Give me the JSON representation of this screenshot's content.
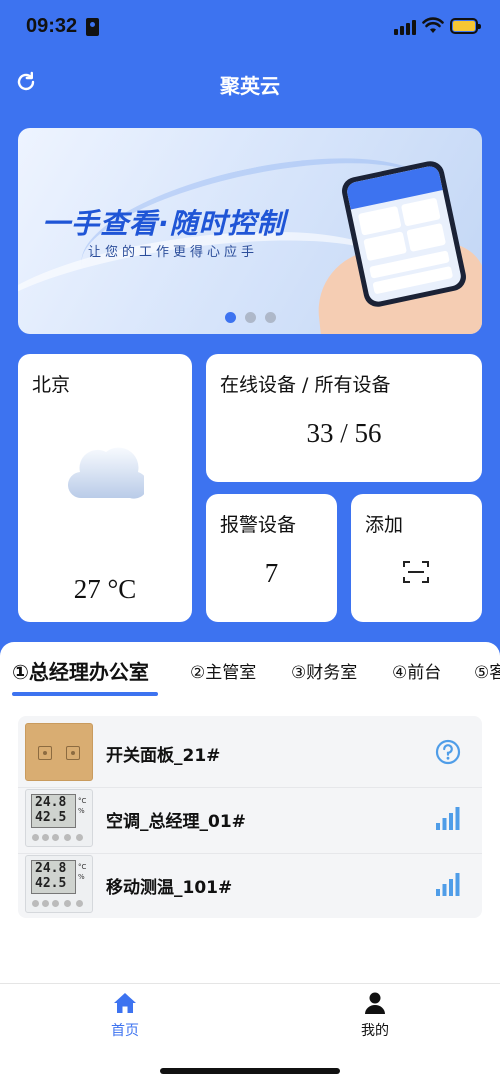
{
  "status_bar": {
    "time": "09:32"
  },
  "header": {
    "title": "聚英云"
  },
  "banner": {
    "title": "一手查看·随时控制",
    "subtitle": "让您的工作更得心应手",
    "active_dot": 0
  },
  "weather": {
    "city": "北京",
    "temperature": "27 °C",
    "icon": "cloud-icon"
  },
  "online": {
    "label": "在线设备 / 所有设备",
    "value": "33 / 56"
  },
  "alarm": {
    "label": "报警设备",
    "value": "7"
  },
  "add": {
    "label": "添加",
    "icon": "scan-icon"
  },
  "tabs": [
    {
      "label": "①总经理办公室"
    },
    {
      "label": "②主管室"
    },
    {
      "label": "③财务室"
    },
    {
      "label": "④前台"
    },
    {
      "label": "⑤客"
    }
  ],
  "devices": [
    {
      "name": "开关面板_21#",
      "status_icon": "question-icon"
    },
    {
      "name": "空调_总经理_01#",
      "status_icon": "signal-bars-icon"
    },
    {
      "name": "移动测温_101#",
      "status_icon": "signal-bars-icon"
    }
  ],
  "bottom_nav": {
    "home": "首页",
    "mine": "我的"
  },
  "colors": {
    "primary": "#3d73f0",
    "status_blue": "#4f9de8"
  }
}
